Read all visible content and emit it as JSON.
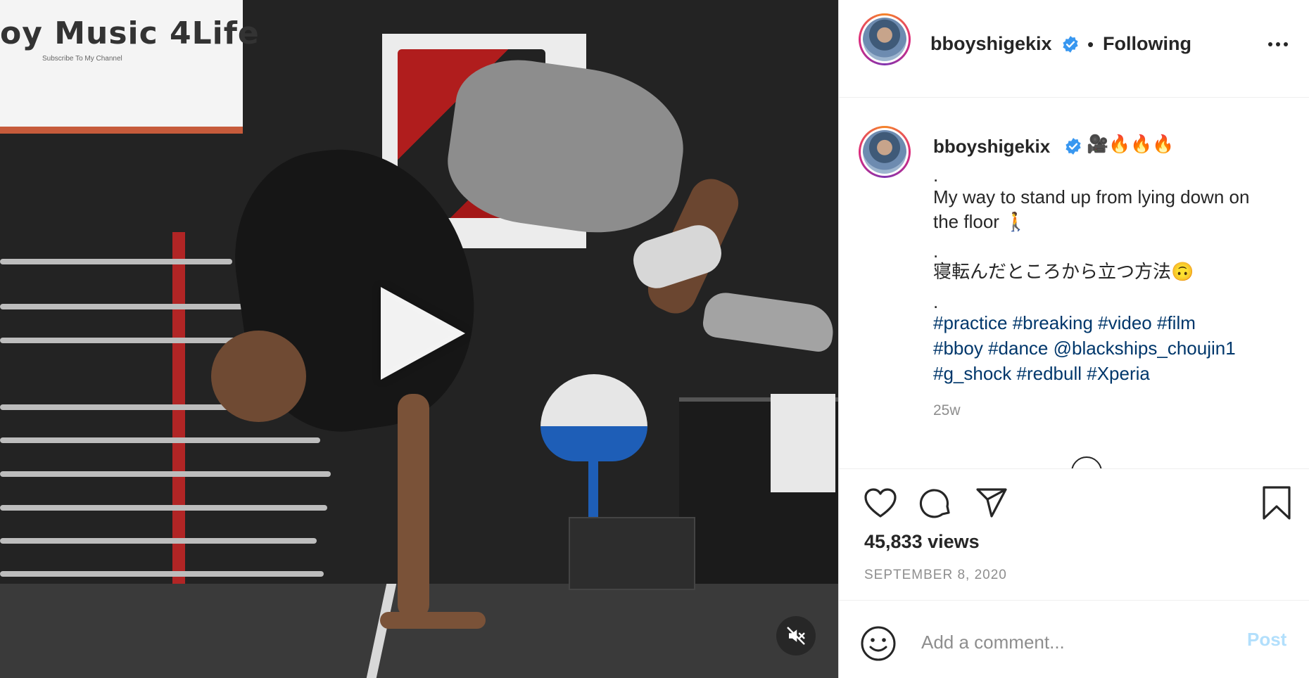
{
  "video": {
    "screen_title": "oy Music 4Life",
    "screen_subtitle": "Subscribe To My Channel"
  },
  "header": {
    "username": "bboyshigekix",
    "separator": "•",
    "following_label": "Following",
    "more_icon": "more-dots-icon"
  },
  "caption": {
    "username": "bboyshigekix",
    "emoji": "🎥🔥🔥🔥",
    "lines": [
      ".",
      "My way to stand up from lying down on",
      "the floor 🚶",
      ".",
      "寝転んだところから立つ方法🙃",
      "."
    ],
    "hashtag_lines": [
      "#practice #breaking #video #film",
      "#bboy #dance @blackships_choujin1",
      "#g_shock #redbull #Xperia"
    ],
    "time": "25w"
  },
  "stats": {
    "views": "45,833 views",
    "date": "SEPTEMBER 8, 2020"
  },
  "comment": {
    "placeholder": "Add a comment...",
    "post_label": "Post"
  },
  "colors": {
    "verified": "#3897f0",
    "hashtag": "#00376b",
    "post_disabled": "#b2dffc"
  }
}
